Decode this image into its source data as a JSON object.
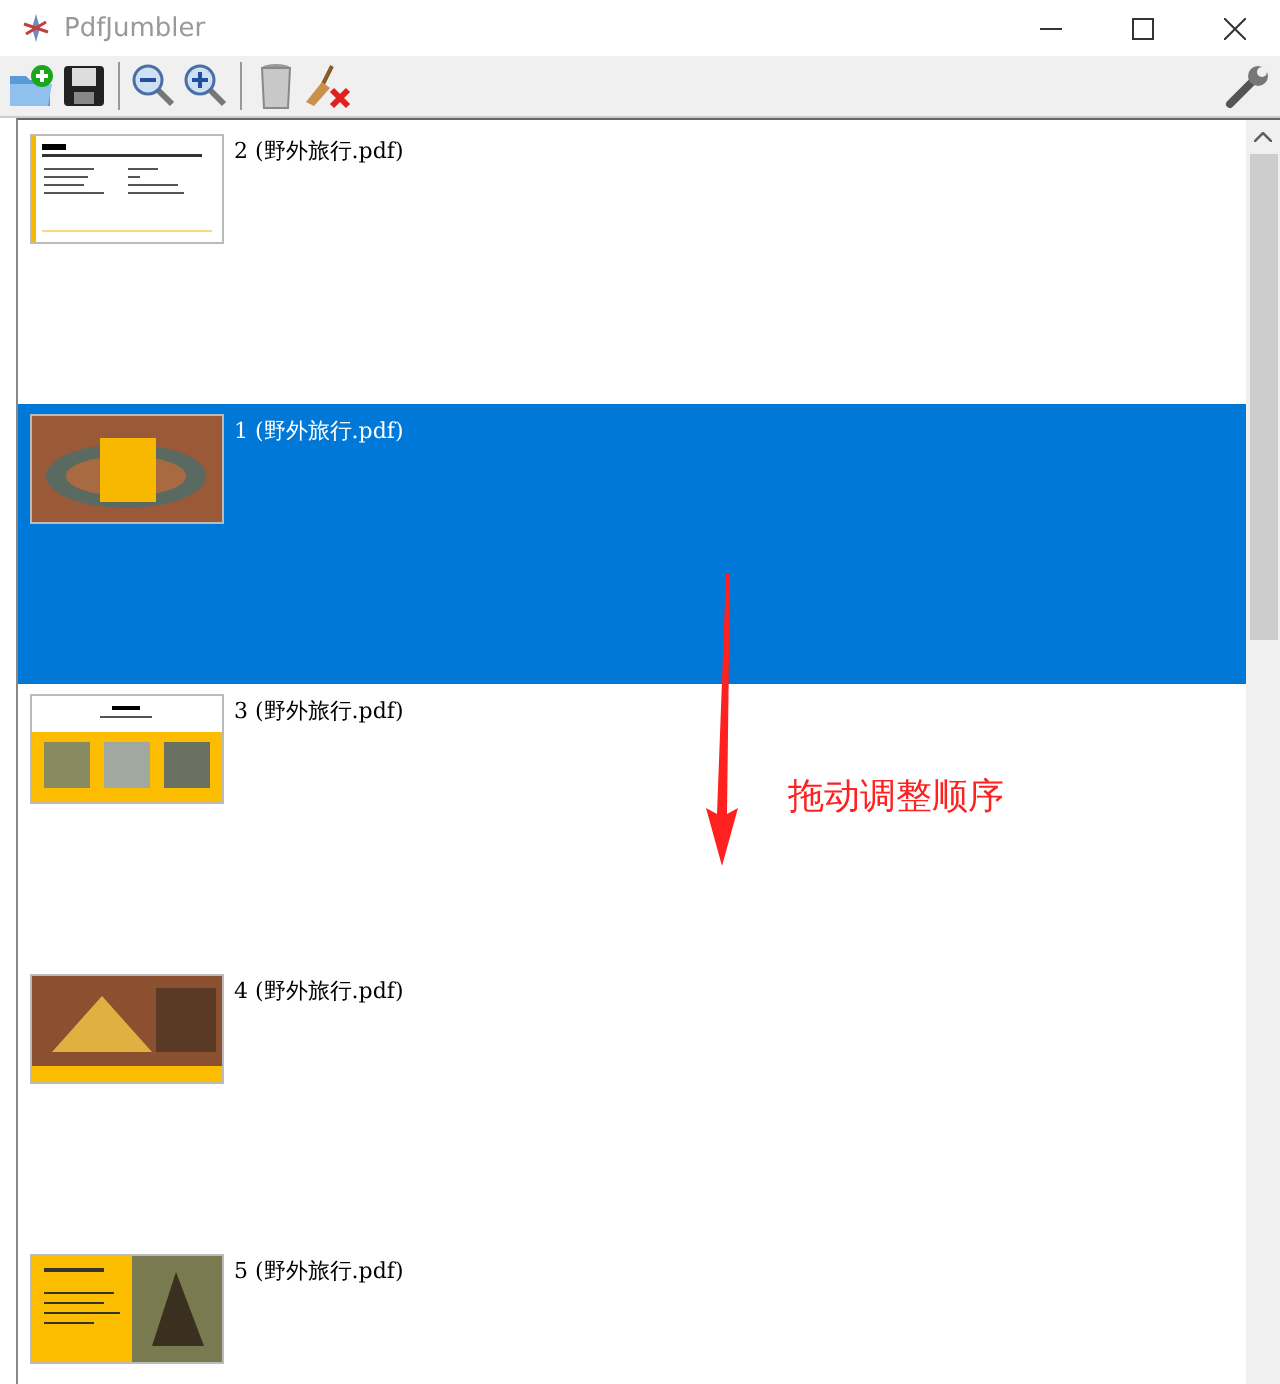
{
  "window": {
    "title": "PdfJumbler"
  },
  "pages": [
    {
      "label": "2 (野外旅行.pdf)",
      "selected": false,
      "kind": "text"
    },
    {
      "label": "1 (野外旅行.pdf)",
      "selected": true,
      "kind": "canyon"
    },
    {
      "label": "3 (野外旅行.pdf)",
      "selected": false,
      "kind": "gallery"
    },
    {
      "label": "4 (野外旅行.pdf)",
      "selected": false,
      "kind": "pyramid"
    },
    {
      "label": "5 (野外旅行.pdf)",
      "selected": false,
      "kind": "split"
    }
  ],
  "annotation": {
    "text": "拖动调整顺序"
  }
}
